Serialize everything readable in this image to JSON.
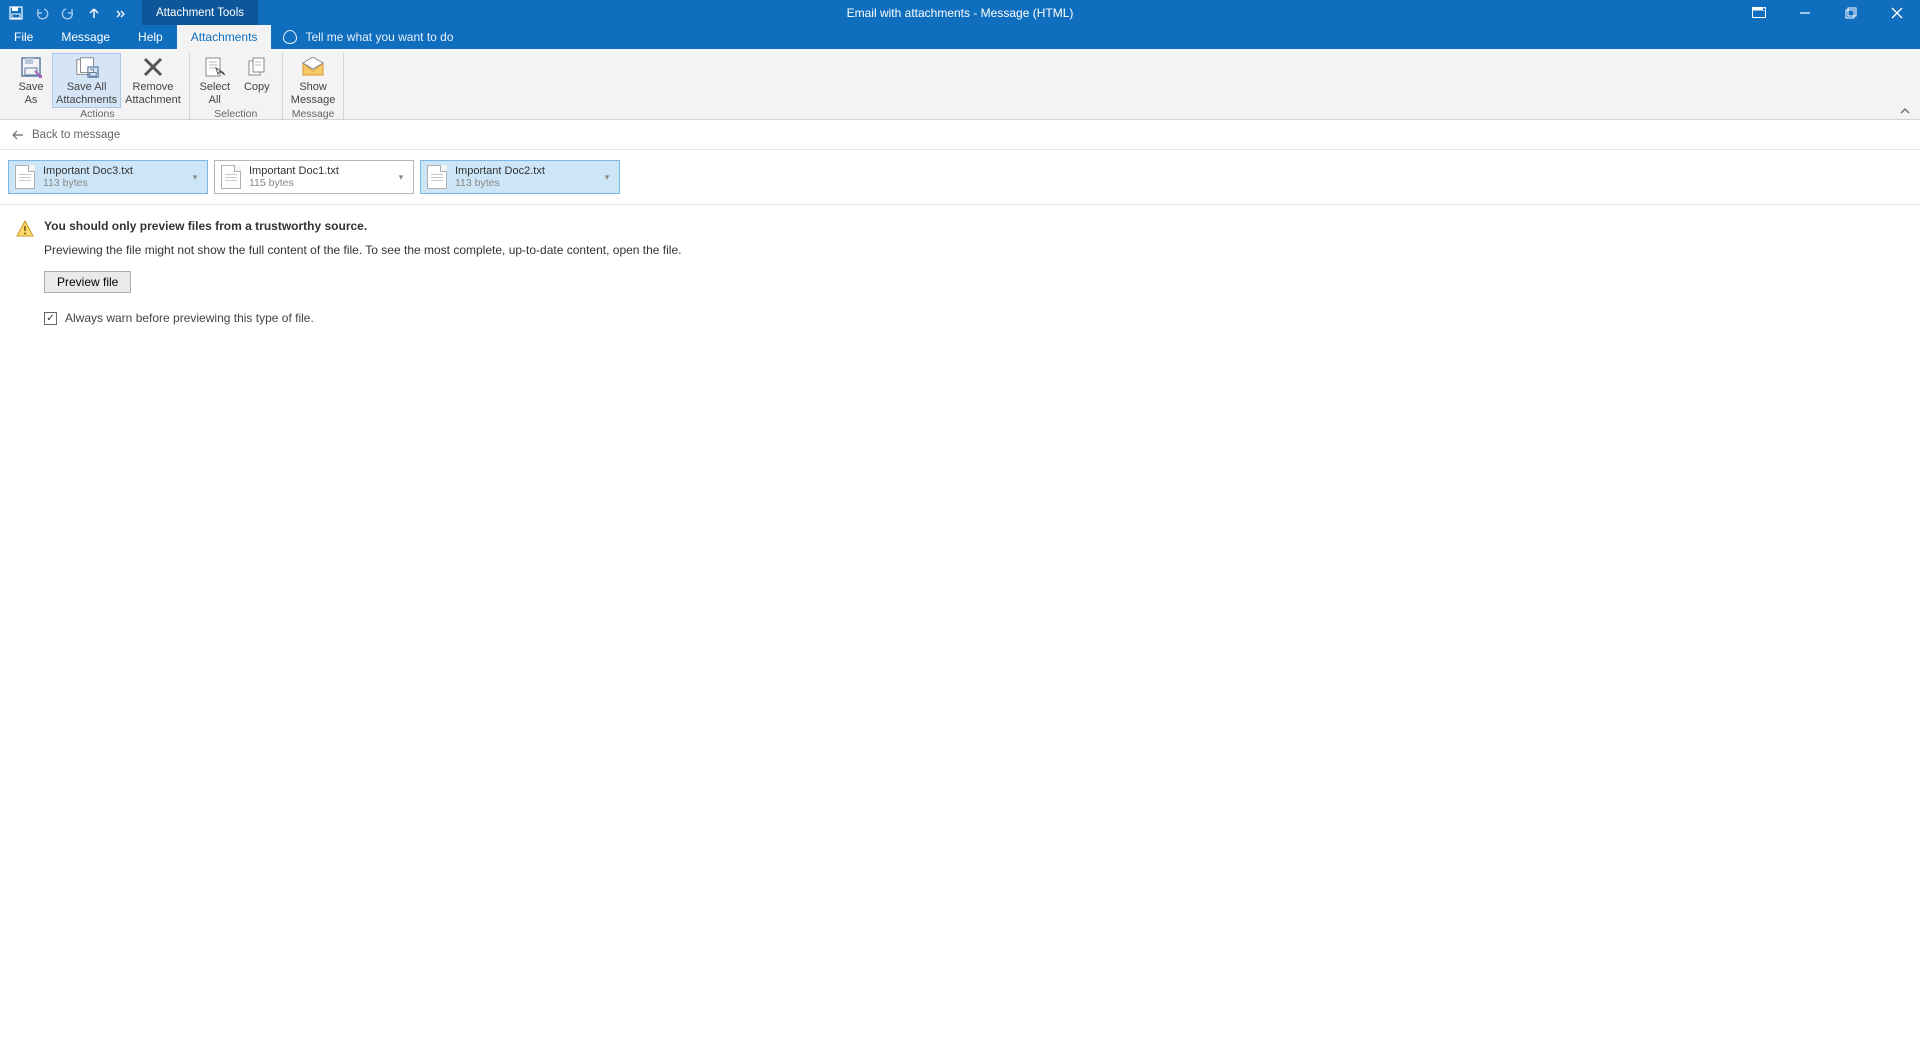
{
  "titlebar": {
    "context_tab": "Attachment Tools",
    "title": "Email with attachments  -  Message (HTML)"
  },
  "menutabs": {
    "file": "File",
    "message": "Message",
    "help": "Help",
    "attachments": "Attachments",
    "tell_me": "Tell me what you want to do"
  },
  "ribbon": {
    "save_as": "Save\nAs",
    "save_all": "Save All\nAttachments",
    "remove": "Remove\nAttachment",
    "select_all": "Select\nAll",
    "copy": "Copy",
    "show_msg": "Show\nMessage",
    "group_actions": "Actions",
    "group_selection": "Selection",
    "group_message": "Message"
  },
  "backbar": {
    "label": "Back to message"
  },
  "attachments": [
    {
      "name": "Important Doc3.txt",
      "size": "113 bytes"
    },
    {
      "name": "Important Doc1.txt",
      "size": "115 bytes"
    },
    {
      "name": "Important Doc2.txt",
      "size": "113 bytes"
    }
  ],
  "preview": {
    "warn_title": "You should only preview files from a trustworthy source.",
    "warn_desc": "Previewing the file might not show the full content of the file. To see the most complete, up-to-date content, open the file.",
    "button": "Preview file",
    "always_warn": "Always warn before previewing this type of file."
  }
}
